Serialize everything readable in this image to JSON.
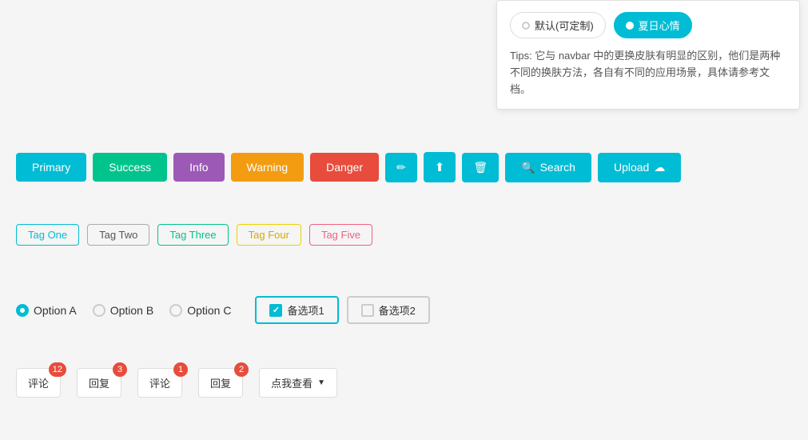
{
  "topCard": {
    "radioOptions": [
      {
        "label": "默认(可定制)",
        "active": false
      },
      {
        "label": "夏日心情",
        "active": true
      }
    ],
    "tips": "Tips: 它与 navbar 中的更换皮肤有明显的区别，他们是两种不同的换肤方法，各自有不同的应用场景，具体请参考文档。"
  },
  "buttons": {
    "items": [
      {
        "label": "Primary",
        "type": "primary"
      },
      {
        "label": "Success",
        "type": "success"
      },
      {
        "label": "Info",
        "type": "info"
      },
      {
        "label": "Warning",
        "type": "warning"
      },
      {
        "label": "Danger",
        "type": "danger"
      },
      {
        "label": "✏",
        "type": "icon-edit"
      },
      {
        "label": "⬆",
        "type": "icon-share"
      },
      {
        "label": "🗑",
        "type": "icon-delete"
      },
      {
        "label": "Search",
        "type": "search",
        "icon": "🔍"
      },
      {
        "label": "Upload",
        "type": "upload",
        "icon": "☁"
      }
    ]
  },
  "tags": {
    "items": [
      {
        "label": "Tag One",
        "style": "one"
      },
      {
        "label": "Tag Two",
        "style": "two"
      },
      {
        "label": "Tag Three",
        "style": "three"
      },
      {
        "label": "Tag Four",
        "style": "four"
      },
      {
        "label": "Tag Five",
        "style": "five"
      }
    ]
  },
  "options": {
    "radios": [
      {
        "label": "Option A",
        "active": true
      },
      {
        "label": "Option B",
        "active": false
      },
      {
        "label": "Option C",
        "active": false
      }
    ],
    "checkboxes": [
      {
        "label": "备选项1",
        "checked": true
      },
      {
        "label": "备选项2",
        "checked": false
      }
    ]
  },
  "badges": {
    "items": [
      {
        "label": "评论",
        "count": "12"
      },
      {
        "label": "回复",
        "count": "3"
      },
      {
        "label": "评论",
        "count": "1"
      },
      {
        "label": "回复",
        "count": "2"
      }
    ],
    "dropdown": {
      "label": "点我查看",
      "arrow": "▼"
    }
  }
}
